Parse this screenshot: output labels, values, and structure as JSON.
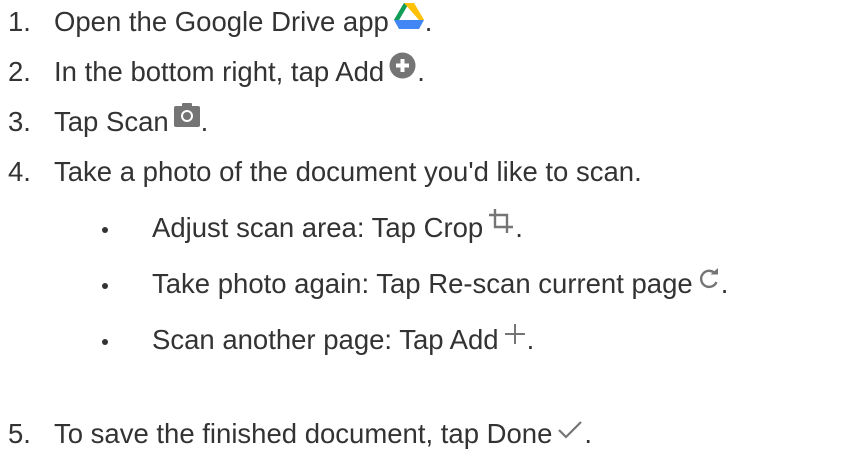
{
  "steps": [
    {
      "number": "1.",
      "text": "Open the Google Drive app",
      "icon": "google-drive-icon",
      "tail": "."
    },
    {
      "number": "2.",
      "text": "In the bottom right, tap Add",
      "icon": "add-circle-icon",
      "tail": "."
    },
    {
      "number": "3.",
      "text": "Tap Scan",
      "icon": "camera-icon",
      "tail": "."
    },
    {
      "number": "4.",
      "text": "Take a photo of the document you'd like to scan."
    },
    {
      "number": "5.",
      "text": "To save the finished document, tap Done",
      "icon": "check-icon",
      "tail": "."
    }
  ],
  "substeps": [
    {
      "text": "Adjust scan area: Tap Crop",
      "icon": "crop-icon",
      "tail": "."
    },
    {
      "text": "Take photo again: Tap Re-scan current page",
      "icon": "rescan-icon",
      "tail": "."
    },
    {
      "text": "Scan another page: Tap Add",
      "icon": "plus-icon",
      "tail": "."
    }
  ],
  "colors": {
    "text": "#333333",
    "icon_gray": "#757575",
    "drive_yellow": "#FFC107",
    "drive_green": "#0F9D58",
    "drive_blue": "#4285F4"
  }
}
